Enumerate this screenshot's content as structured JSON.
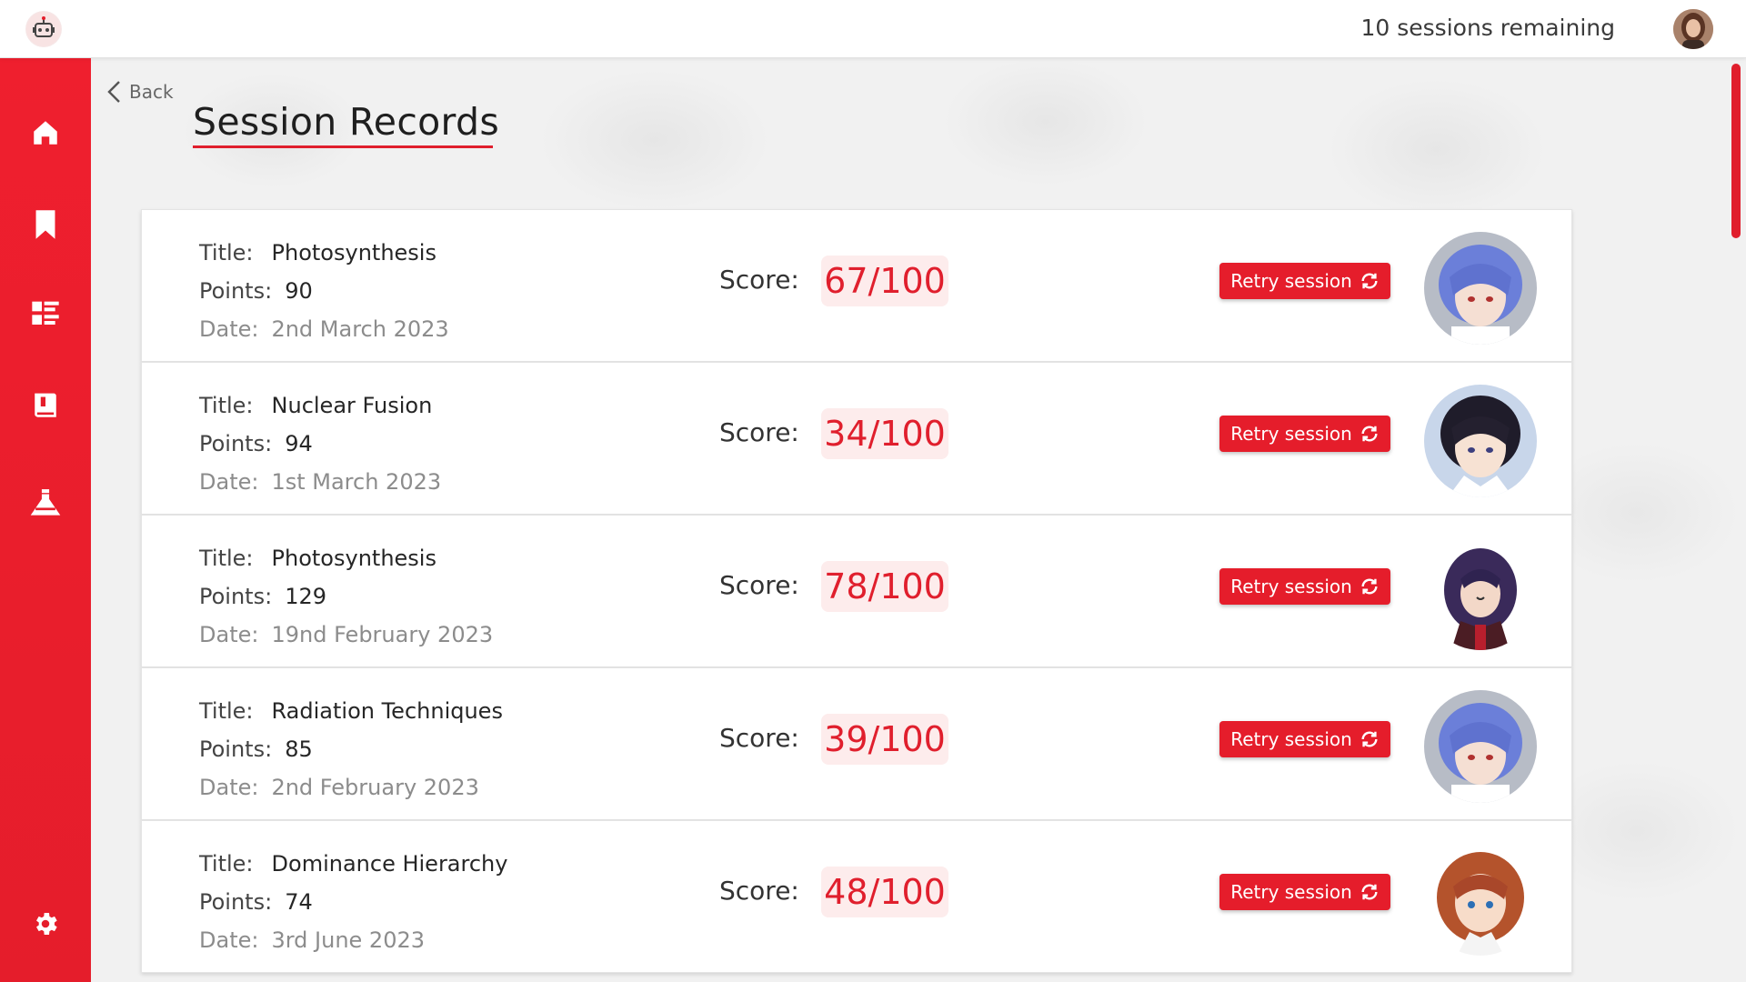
{
  "header": {
    "sessions_remaining": "10 sessions remaining",
    "logo_icon": "robot-mascot-icon",
    "avatar_icon": "user-avatar"
  },
  "sidebar": {
    "items": [
      {
        "icon": "home-icon"
      },
      {
        "icon": "bookmark-icon"
      },
      {
        "icon": "list-icon"
      },
      {
        "icon": "book-icon"
      },
      {
        "icon": "flask-icon"
      }
    ],
    "settings_icon": "gear-icon"
  },
  "page": {
    "back_label": "Back",
    "title": "Session Records",
    "labels": {
      "title": "Title:",
      "points": "Points:",
      "date": "Date:",
      "score": "Score:",
      "retry": "Retry session"
    }
  },
  "records": [
    {
      "title": "Photosynthesis",
      "points": "90",
      "date": "2nd March 2023",
      "score": "67/100",
      "avatar": "blue-hair-character"
    },
    {
      "title": "Nuclear Fusion",
      "points": "94",
      "date": "1st March 2023",
      "score": "34/100",
      "avatar": "dark-hair-character"
    },
    {
      "title": "Photosynthesis",
      "points": "129",
      "date": "19nd February 2023",
      "score": "78/100",
      "avatar": "purple-hair-character"
    },
    {
      "title": "Radiation Techniques",
      "points": "85",
      "date": "2nd February 2023",
      "score": "39/100",
      "avatar": "blue-hair-character"
    },
    {
      "title": "Dominance Hierarchy",
      "points": "74",
      "date": "3rd June 2023",
      "score": "48/100",
      "avatar": "red-hair-character"
    }
  ],
  "colors": {
    "accent": "#e51d2b",
    "score_bg": "#fdecec",
    "sidebar": "#ef1f2e"
  }
}
